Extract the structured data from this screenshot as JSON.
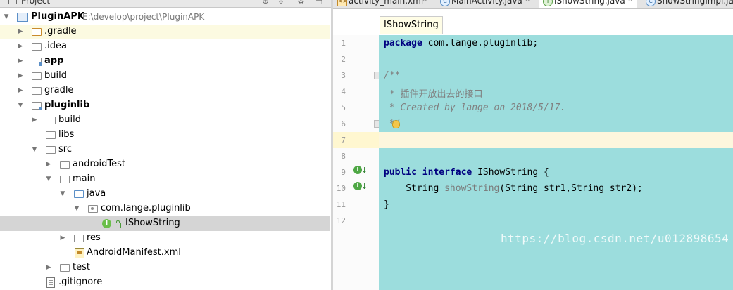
{
  "project_panel": {
    "header_label": "Project",
    "tree": [
      {
        "label": "PluginAPK",
        "path": "E:\\develop\\project\\PluginAPK",
        "bold": true
      },
      {
        "label": ".gradle"
      },
      {
        "label": ".idea"
      },
      {
        "label": "app",
        "bold": true
      },
      {
        "label": "build"
      },
      {
        "label": "gradle"
      },
      {
        "label": "pluginlib",
        "bold": true
      },
      {
        "label": "build"
      },
      {
        "label": "libs"
      },
      {
        "label": "src"
      },
      {
        "label": "androidTest"
      },
      {
        "label": "main"
      },
      {
        "label": "java"
      },
      {
        "label": "com.lange.pluginlib"
      },
      {
        "label": "IShowString",
        "selected": true
      },
      {
        "label": "res"
      },
      {
        "label": "AndroidManifest.xml"
      },
      {
        "label": "test"
      },
      {
        "label": ".gitignore"
      }
    ]
  },
  "editor": {
    "tabs": [
      {
        "label": "activity_main.xml",
        "icon": "xml-file-icon"
      },
      {
        "label": "MainActivity.java",
        "icon": "class-icon"
      },
      {
        "label": "IShowString.java",
        "icon": "interface-icon",
        "active": true
      },
      {
        "label": "ShowStringImpl.java",
        "icon": "class-icon"
      }
    ],
    "breadcrumb": "IShowString",
    "line_numbers": [
      "1",
      "2",
      "3",
      "4",
      "5",
      "6",
      "7",
      "8",
      "9",
      "10",
      "11",
      "12"
    ],
    "code": {
      "l1_kw": "package",
      "l1_rest": " com.lange.pluginlib;",
      "l3": "/**",
      "l4_star": " * ",
      "l4_text": "插件开放出去的接口",
      "l5": " * Created by lange on 2018/5/17.",
      "l6": " */",
      "l9_kw1": "public",
      "l9_kw2": "interface",
      "l9_rest": " IShowString {",
      "l10_pre": "    String ",
      "l10_fn": "showString",
      "l10_rest": "(String str1,String str2);",
      "l11": "}"
    },
    "watermark": "https://blog.csdn.net/u012898654"
  },
  "colors": {
    "code_background": "#9cdddd",
    "keyword": "#000080",
    "comment": "#808080",
    "caret_line": "#fdf6dd",
    "tree_highlight": "#fcfae1",
    "tree_selected": "#d5d5d5"
  }
}
